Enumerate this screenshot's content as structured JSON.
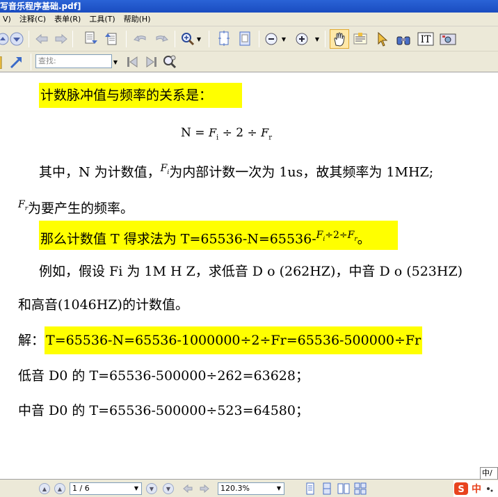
{
  "window": {
    "title": "写音乐程序基础.pdf]"
  },
  "menubar": {
    "items": [
      "V)",
      "注释(C)",
      "表单(R)",
      "工具(T)",
      "帮助(H)"
    ]
  },
  "toolbar": {
    "search_placeholder": "查找:"
  },
  "document": {
    "line1": "计数脉冲值与频率的关系是：",
    "formula1": {
      "prefix": "N = ",
      "fi": "F",
      "fi_sub": "i",
      "mid": " ÷ 2 ÷ ",
      "fr": "F",
      "fr_sub": "r"
    },
    "line3_a": "其中，N 为计数值，",
    "line3_b": "为内部计数一次为 1us，故其频率为 1MHZ;",
    "line4": "为要产生的频率。",
    "line5_a": "那么计数值 T 得求法为 T=65536-N=65536-",
    "line5_formula": "÷2÷",
    "line5_end": "。",
    "line6": "例如，假设 Fi 为 1M H Z，求低音 D  o (262HZ)，中音 D  o (523HZ)",
    "line7": "和高音(1046HZ)的计数值。",
    "line8_label": "解：",
    "line8_formula": "T=65536-N=65536-1000000÷2÷Fr=65536-500000÷Fr",
    "line9": "低音 D0 的 T=65536-500000÷262=63628；",
    "line10": "中音 D0 的 T=65536-500000÷523=64580；"
  },
  "statusbar": {
    "page_display": "1 / 6",
    "zoom": "120.3%"
  },
  "ime": {
    "tooltip": "中/",
    "mode": "中"
  },
  "colors": {
    "highlight": "#ffff00",
    "titlebar": "#2a63d6",
    "chrome": "#ece9d8"
  }
}
